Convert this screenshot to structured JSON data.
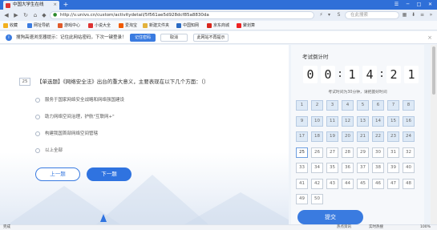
{
  "browser": {
    "tab_title": "中国大学生在线",
    "new_tab": "+",
    "url": "http://v.univs.cn/custom/activitydetail/5f561ae5d928dcf85a8830da",
    "search_placeholder": "在此搜索",
    "window_buttons": [
      "─",
      "□",
      "✕"
    ]
  },
  "bookmarks": [
    {
      "label": "收藏",
      "color": "#f2b01e"
    },
    {
      "label": "网址导航",
      "color": "#3a7be0"
    },
    {
      "label": "游戏中心",
      "color": "#e05a2a"
    },
    {
      "label": "小说大全",
      "color": "#d33"
    },
    {
      "label": "爱淘宝",
      "color": "#f05a00"
    },
    {
      "label": "新建文件夹",
      "color": "#e3b23c"
    },
    {
      "label": "中国知网",
      "color": "#2a6bc4"
    },
    {
      "label": "京东商城",
      "color": "#d8261d"
    },
    {
      "label": "聚划算",
      "color": "#e22"
    }
  ],
  "password_bar": {
    "message": "搜狗高速浏览器提示：记住此网站密码，下次一键登录！",
    "save": "记住密码",
    "cancel": "取消",
    "never": "此网站不再提示"
  },
  "question": {
    "number": "25",
    "text": "【单选题】《网络安全法》出台的重大意义，主要表现在以下几个方面：（）",
    "options": [
      "服务于国家网络安全战略和网络强国建设",
      "助力网络空间治理，护航\"互联网+\"",
      "构建我国首部网络空间管辖",
      "以上全部"
    ],
    "prev": "上一题",
    "next": "下一题"
  },
  "countdown": {
    "title": "考试倒计时",
    "digits": [
      "0",
      "0",
      "1",
      "4",
      "2",
      "1"
    ],
    "hint": "考试时间为30分钟，请把握好时间"
  },
  "question_grid": {
    "numbers": [
      "1",
      "2",
      "3",
      "4",
      "5",
      "6",
      "7",
      "8",
      "9",
      "10",
      "11",
      "12",
      "13",
      "14",
      "15",
      "16",
      "17",
      "18",
      "19",
      "20",
      "21",
      "22",
      "23",
      "24",
      "25",
      "26",
      "27",
      "28",
      "29",
      "30",
      "31",
      "32",
      "33",
      "34",
      "35",
      "36",
      "37",
      "38",
      "39",
      "40",
      "41",
      "42",
      "43",
      "44",
      "45",
      "46",
      "47",
      "48",
      "49",
      "50"
    ],
    "answered_through": 24,
    "current": 25
  },
  "submit_label": "提交",
  "status_bar": {
    "left": "完成",
    "items": [
      "热点资讯",
      "实时热搜",
      "100%"
    ]
  },
  "colors": {
    "accent": "#3a7be0",
    "answered": "#dde9f6"
  }
}
